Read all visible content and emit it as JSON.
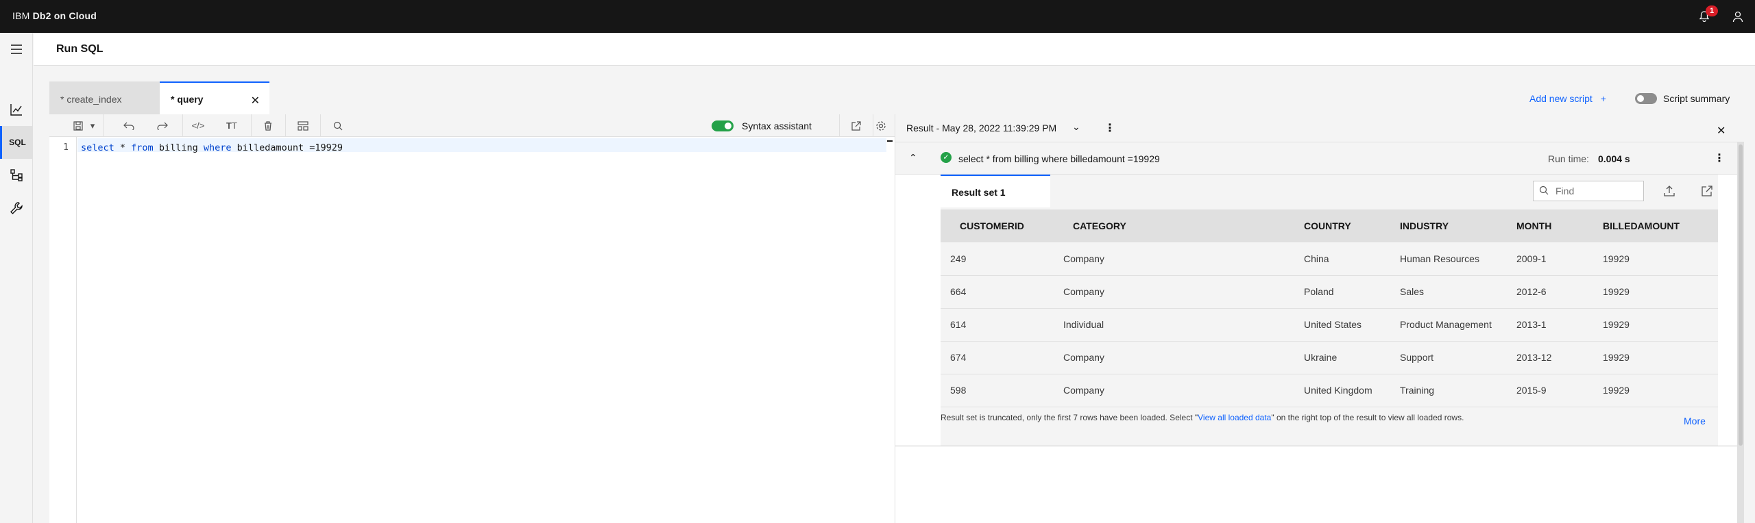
{
  "header": {
    "brand_prefix": "IBM ",
    "brand_name": "Db2 on Cloud",
    "notification_count": "1"
  },
  "sidebar": {
    "items": [
      {
        "name": "monitor",
        "label": ""
      },
      {
        "name": "sql",
        "label": "SQL"
      },
      {
        "name": "data",
        "label": ""
      },
      {
        "name": "administration",
        "label": ""
      }
    ]
  },
  "page": {
    "title": "Run SQL"
  },
  "script_tabs": [
    {
      "label": "* create_index"
    },
    {
      "label": "* query"
    }
  ],
  "actions": {
    "add_script": "Add new script",
    "script_summary": "Script summary"
  },
  "editor": {
    "syntax_assistant": "Syntax assistant",
    "line_number": "1",
    "code_tokens": [
      {
        "text": "select",
        "kw": true
      },
      {
        "text": " * ",
        "kw": false
      },
      {
        "text": "from",
        "kw": true
      },
      {
        "text": " billing ",
        "kw": false
      },
      {
        "text": "where",
        "kw": true
      },
      {
        "text": " billedamount =19929",
        "kw": false
      }
    ]
  },
  "result": {
    "title": "Result - May 28, 2022 11:39:29 PM",
    "sql": "select * from billing where billedamount =19929",
    "runtime_label": "Run time:",
    "runtime_value": "0.004 s",
    "tab_label": "Result set 1",
    "find_placeholder": "Find",
    "columns": [
      "CUSTOMERID",
      "CATEGORY",
      "COUNTRY",
      "INDUSTRY",
      "MONTH",
      "BILLEDAMOUNT"
    ],
    "rows": [
      [
        "249",
        "Company",
        "China",
        "Human Resources",
        "2009-1",
        "19929"
      ],
      [
        "664",
        "Company",
        "Poland",
        "Sales",
        "2012-6",
        "19929"
      ],
      [
        "614",
        "Individual",
        "United States",
        "Product Management",
        "2013-1",
        "19929"
      ],
      [
        "674",
        "Company",
        "Ukraine",
        "Support",
        "2013-12",
        "19929"
      ],
      [
        "598",
        "Company",
        "United Kingdom",
        "Training",
        "2015-9",
        "19929"
      ]
    ],
    "truncated_prefix": "Result set is truncated, only the first 7 rows have been loaded. Select \"",
    "truncated_link": "View all loaded data",
    "truncated_suffix": "\" on the right top of the result to view all loaded rows.",
    "more": "More"
  }
}
